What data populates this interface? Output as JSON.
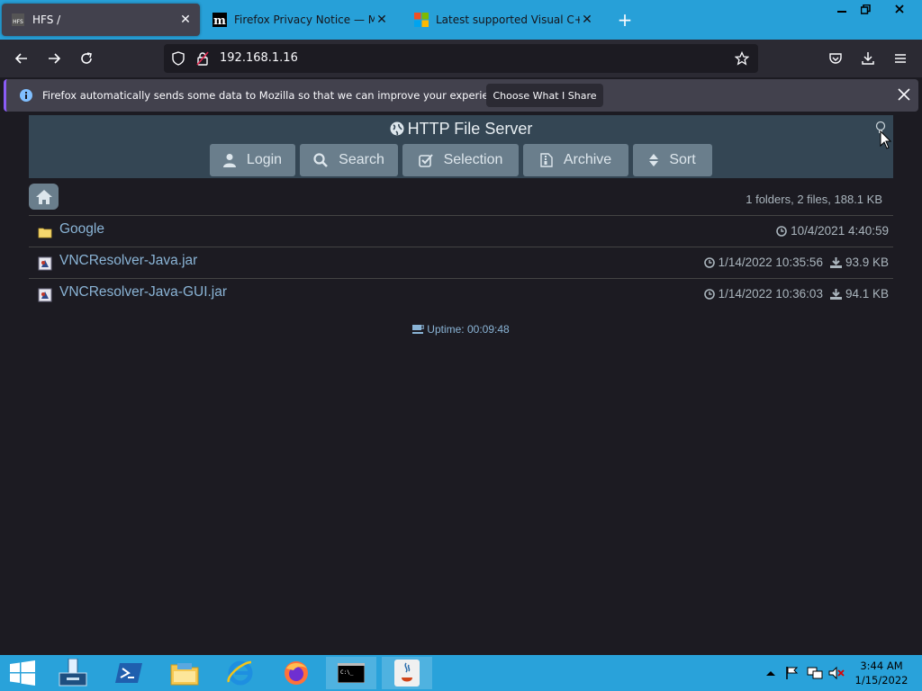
{
  "browser": {
    "tabs": [
      {
        "label": "HFS /",
        "active": true,
        "favicon": "hfs-icon"
      },
      {
        "label": "Firefox Privacy Notice — Mozilla",
        "active": false,
        "favicon": "mozilla-m-icon"
      },
      {
        "label": "Latest supported Visual C++ Re",
        "active": false,
        "favicon": "microsoft-logo-icon"
      }
    ],
    "url": "192.168.1.16",
    "notification": {
      "text": "Firefox automatically sends some data to Mozilla so that we can improve your experience.",
      "button": "Choose What I Share"
    }
  },
  "hfs": {
    "title": "HTTP File Server",
    "buttons": {
      "login": "Login",
      "search": "Search",
      "selection": "Selection",
      "archive": "Archive",
      "sort": "Sort"
    },
    "summary": "1 folders, 2 files, 188.1 KB",
    "items": [
      {
        "name": "Google",
        "type": "folder",
        "date": "10/4/2021 4:40:59",
        "size": ""
      },
      {
        "name": "VNCResolver-Java.jar",
        "type": "file",
        "date": "1/14/2022 10:35:56",
        "size": "93.9 KB"
      },
      {
        "name": "VNCResolver-Java-GUI.jar",
        "type": "file",
        "date": "1/14/2022 10:36:03",
        "size": "94.1 KB"
      }
    ],
    "uptime": "Uptime: 00:09:48"
  },
  "taskbar": {
    "time": "3:44 AM",
    "date": "1/15/2022"
  }
}
